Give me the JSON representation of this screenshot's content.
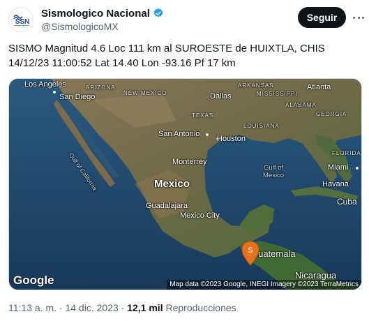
{
  "account": {
    "display_name": "Sismologico Nacional",
    "handle": "@SismologicoMX",
    "avatar_text": "SSN",
    "verified_color": "#1d9bf0"
  },
  "follow_button": {
    "label": "Seguir"
  },
  "more_button": {
    "icon": "more-icon"
  },
  "tweet": {
    "text": "SISMO Magnitud 4.6 Loc  111 km al SUROESTE de HUIXTLA, CHIS\n14/12/23 11:00:52 Lat 14.40 Lon -93.16 Pf 17 km"
  },
  "map": {
    "labels": {
      "los_angeles": "Los Angeles",
      "san_diego": "San Diego",
      "arizona": "ARIZONA",
      "new_mexico": "NEW MEXICO",
      "arkansas": "ARKANSAS",
      "atlanta": "Atlanta",
      "dallas": "Dallas",
      "mississippi": "MISSISSIPPI",
      "alabama": "ALABAMA",
      "texas": "TEXAS",
      "georgia": "GEORGIA",
      "louisiana": "LOUISIANA",
      "san_antonio": "San Antonio",
      "houston": "Houston",
      "gulf_of_california": "Gulf of California",
      "florida": "FLORIDA",
      "monterrey": "Monterrey",
      "gulf_of_mexico": "Gulf of\nMexico",
      "miami": "Miami",
      "mexico": "Mexico",
      "havana": "Havana",
      "guadalajara": "Guadalajara",
      "cuba": "Cuba",
      "mexico_city": "Mexico City",
      "guatemala": "Guatemala",
      "nicaragua": "Nicaragua"
    },
    "marker_label": "S",
    "marker_color": "#e8711b",
    "google": "Google",
    "attribution": "Map data ©2023 Google, INEGI Imagery ©2023 TerraMetrics"
  },
  "meta": {
    "time": "11:13 a. m.",
    "separator": "·",
    "date": "14 dic. 2023",
    "views": "12,1 mil",
    "views_label": "Reproducciones"
  }
}
